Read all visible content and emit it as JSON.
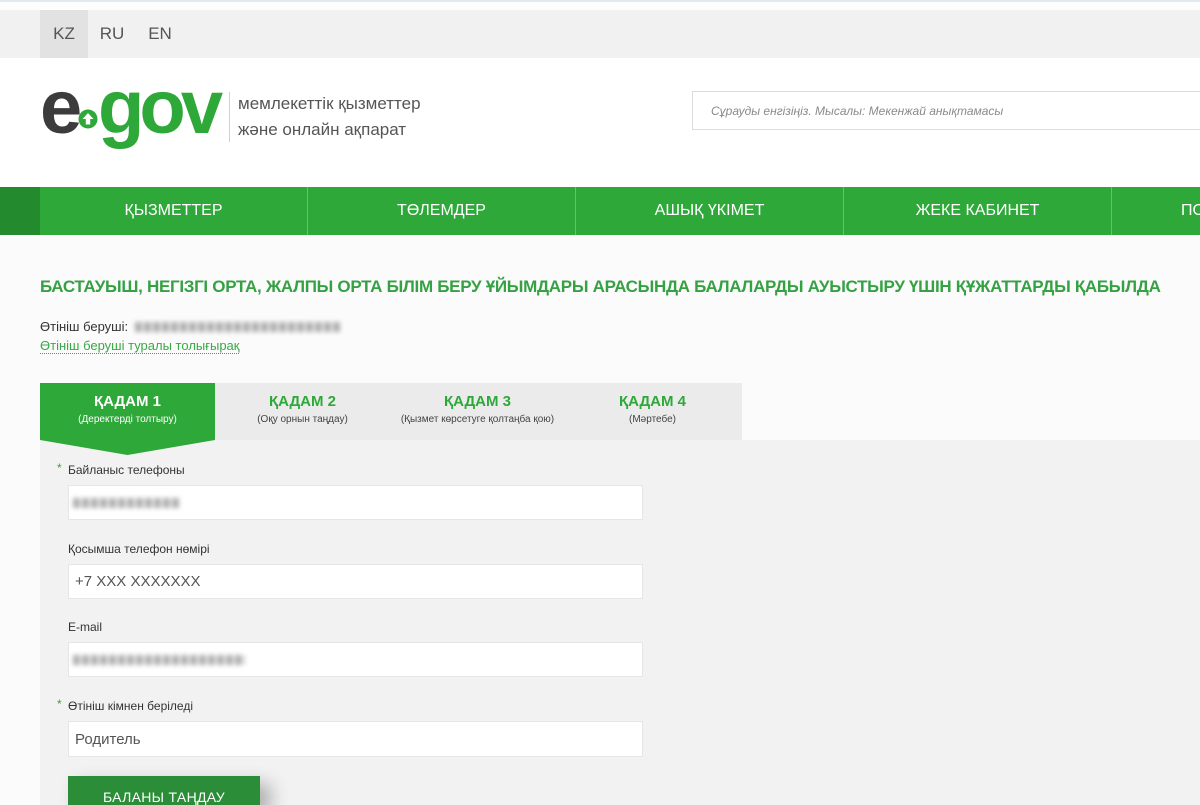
{
  "lang_bar": {
    "selected": "KZ",
    "items": [
      "KZ",
      "RU",
      "EN"
    ]
  },
  "header": {
    "logo": {
      "e": "e",
      "gov": "gov",
      "icon": "arrow-circle-icon"
    },
    "tagline": [
      "мемлекеттік қызметтер",
      "және онлайн ақпарат"
    ],
    "search": {
      "placeholder": "Сұрауды енгізіңіз. Мысалы: Мекенжай анықтамасы"
    }
  },
  "nav": {
    "items": [
      "ҚЫЗМЕТТЕР",
      "ТӨЛЕМДЕР",
      "АШЫҚ ҮКІМЕТ",
      "ЖЕКЕ КАБИНЕТ",
      "ПО"
    ]
  },
  "page": {
    "title": "БАСТАУЫШ, НЕГІЗГІ ОРТА, ЖАЛПЫ ОРТА БІЛІМ БЕРУ ҰЙЫМДАРЫ АРАСЫНДА БАЛАЛАРДЫ АУЫСТЫРУ ҮШІН ҚҰЖАТТАРДЫ ҚАБЫЛДА",
    "applicant_label": "Өтініш беруші:",
    "applicant_details_link": "Өтініш беруші туралы толығырақ"
  },
  "steps": {
    "current": 1,
    "items": [
      {
        "title": "ҚАДАМ 1",
        "subtitle": "(Деректерді толтыру)"
      },
      {
        "title": "ҚАДАМ 2",
        "subtitle": "(Оқу орнын таңдау)"
      },
      {
        "title": "ҚАДАМ 3",
        "subtitle": "(Қызмет көрсетуге қолтаңба қою)"
      },
      {
        "title": "ҚАДАМ 4",
        "subtitle": "(Мәртебе)"
      }
    ]
  },
  "form": {
    "required_mark": "*",
    "fields": [
      {
        "label": "Байланыс телефоны",
        "required": true
      },
      {
        "label": "Қосымша телефон нөмірі",
        "required": false,
        "placeholder": "+7 XXX XXXXXXX"
      },
      {
        "label": "E-mail",
        "required": false
      },
      {
        "label": "Өтініш кімнен беріледі",
        "required": true,
        "value": "Родитель"
      }
    ],
    "submit_label": "БАЛАНЫ ТАҢДАУ"
  },
  "colors": {
    "brand_green": "#2fa83a",
    "dark_green": "#238a2e",
    "logo_gray": "#3c3c3c",
    "button_green": "#2b8d37",
    "title_green": "#35a143",
    "link_green": "#3aa845"
  }
}
